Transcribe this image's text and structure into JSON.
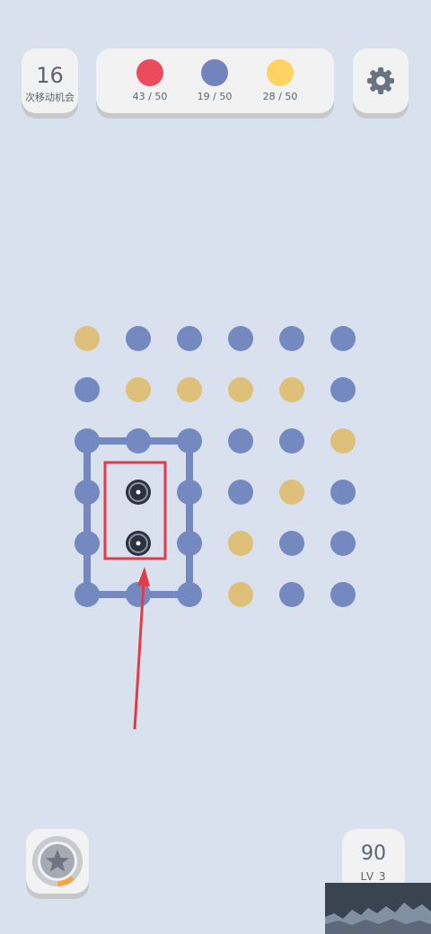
{
  "moves": {
    "count": "16",
    "label": "次移动机会"
  },
  "goals": [
    {
      "color": "#ec4b5e",
      "text": "43 / 50"
    },
    {
      "color": "#7384bd",
      "text": "19 / 50"
    },
    {
      "color": "#fdd464",
      "text": "28 / 50"
    }
  ],
  "settings": {
    "icon": "gear-icon"
  },
  "board": {
    "colors": {
      "b": "#7389bf",
      "y": "#dfc07a",
      "x": "#2a3140"
    },
    "grid": [
      [
        "y",
        "b",
        "b",
        "b",
        "b",
        "b"
      ],
      [
        "b",
        "y",
        "y",
        "y",
        "y",
        "b"
      ],
      [
        "b",
        "b",
        "b",
        "b",
        "b",
        "y"
      ],
      [
        "b",
        "x",
        "b",
        "b",
        "y",
        "b"
      ],
      [
        "b",
        "x",
        "b",
        "y",
        "b",
        "b"
      ],
      [
        "b",
        "b",
        "b",
        "y",
        "b",
        "b"
      ]
    ],
    "highlight_color": "#e13b47"
  },
  "powerup": {
    "icon": "star-icon",
    "progress": 0.12
  },
  "score": {
    "value": "90",
    "level": "LV 3"
  }
}
